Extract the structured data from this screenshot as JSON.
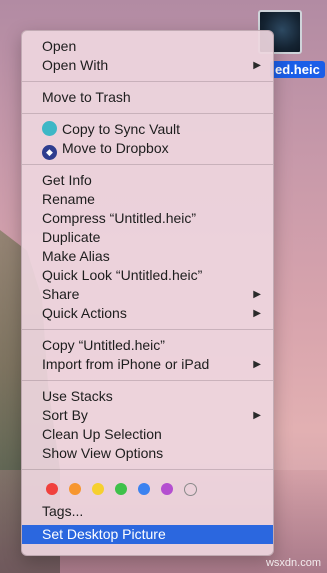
{
  "desktop": {
    "file_label": "ed.heic",
    "watermark": "wsxdn.com"
  },
  "menu": {
    "group1": [
      {
        "label": "Open",
        "submenu": false
      },
      {
        "label": "Open With",
        "submenu": true
      }
    ],
    "group2": [
      {
        "label": "Move to Trash",
        "submenu": false
      }
    ],
    "group3": [
      {
        "label": "Copy to Sync Vault",
        "icon": "sync-vault-icon"
      },
      {
        "label": "Move to Dropbox",
        "icon": "dropbox-icon"
      }
    ],
    "group4": [
      {
        "label": "Get Info",
        "submenu": false
      },
      {
        "label": "Rename",
        "submenu": false
      },
      {
        "label": "Compress “Untitled.heic”",
        "submenu": false
      },
      {
        "label": "Duplicate",
        "submenu": false
      },
      {
        "label": "Make Alias",
        "submenu": false
      },
      {
        "label": "Quick Look “Untitled.heic”",
        "submenu": false
      },
      {
        "label": "Share",
        "submenu": true
      },
      {
        "label": "Quick Actions",
        "submenu": true
      }
    ],
    "group5": [
      {
        "label": "Copy “Untitled.heic”",
        "submenu": false
      },
      {
        "label": "Import from iPhone or iPad",
        "submenu": true
      }
    ],
    "group6": [
      {
        "label": "Use Stacks",
        "submenu": false
      },
      {
        "label": "Sort By",
        "submenu": true
      },
      {
        "label": "Clean Up Selection",
        "submenu": false
      },
      {
        "label": "Show View Options",
        "submenu": false
      }
    ],
    "tag_colors": [
      {
        "name": "red",
        "color": "#f0403c"
      },
      {
        "name": "orange",
        "color": "#f7962f"
      },
      {
        "name": "yellow",
        "color": "#f6d02e"
      },
      {
        "name": "green",
        "color": "#3ec14a"
      },
      {
        "name": "blue",
        "color": "#3b82f0"
      },
      {
        "name": "purple",
        "color": "#b44fd0"
      },
      {
        "name": "gray",
        "color": "none"
      }
    ],
    "tags_label": "Tags...",
    "selected_item": "Set Desktop Picture",
    "selected_color": "#2b67df",
    "submenu_arrow": "▶"
  }
}
